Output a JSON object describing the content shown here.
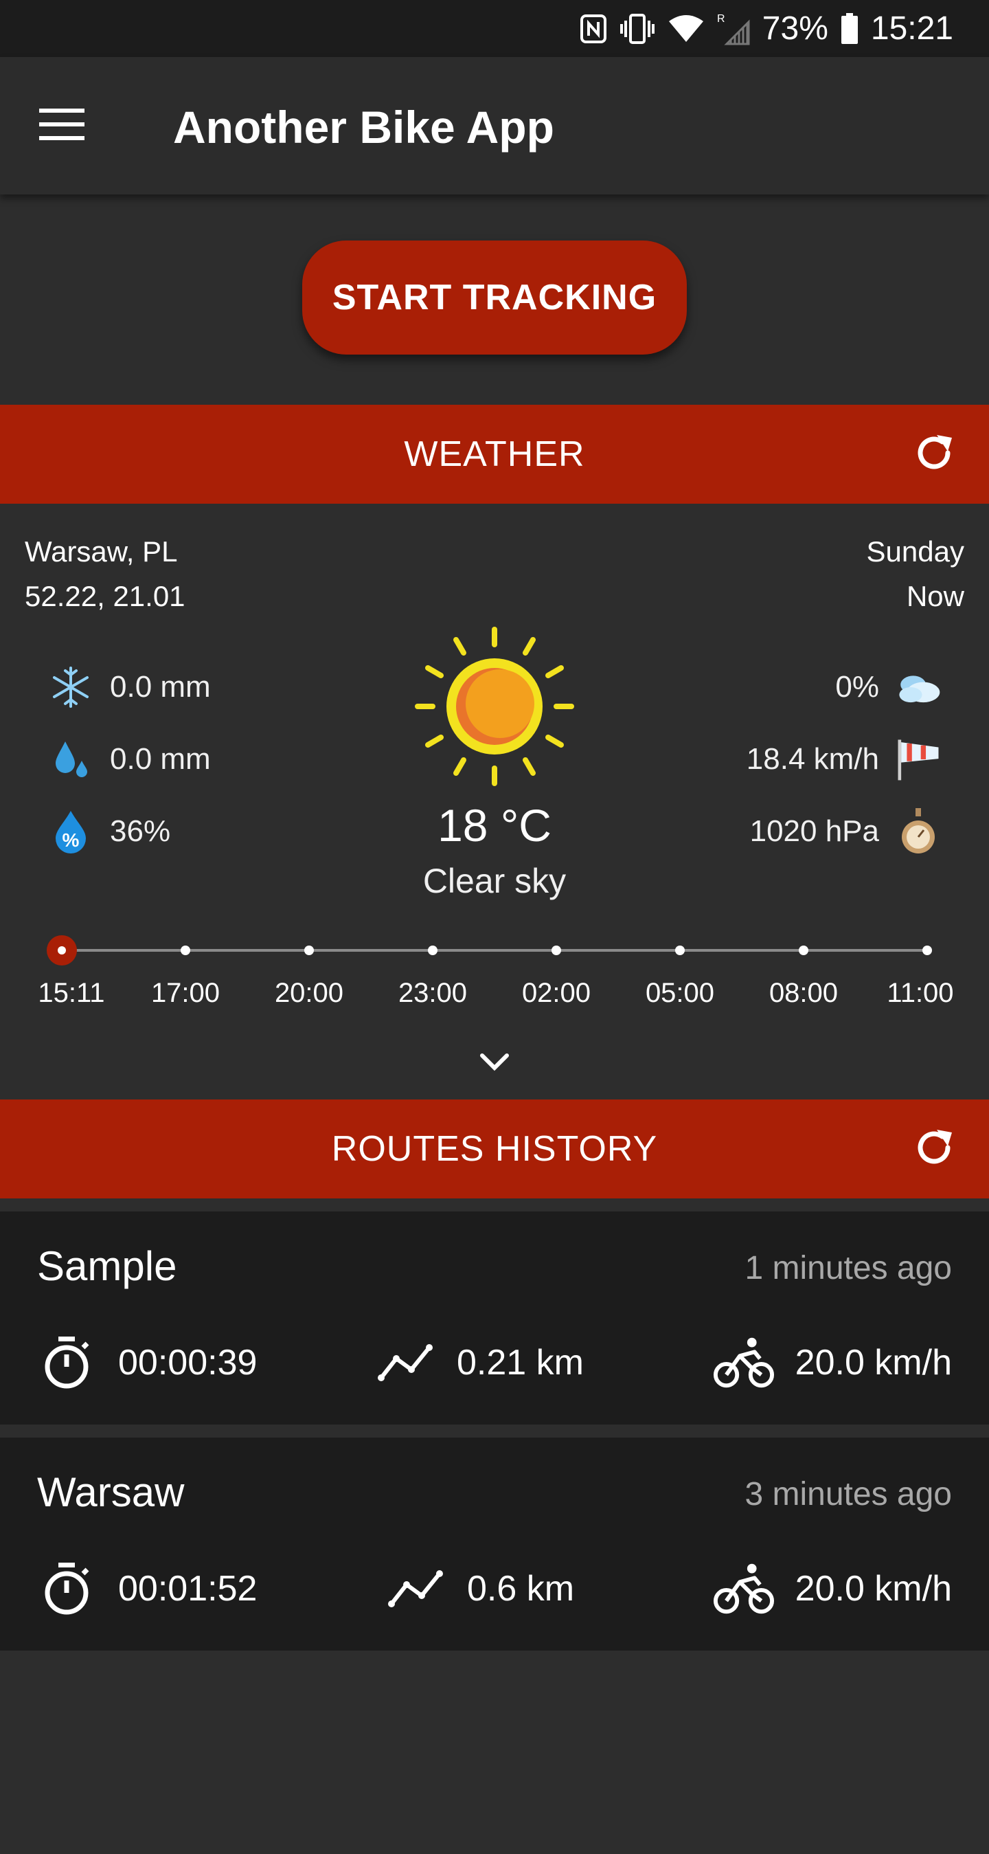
{
  "status_bar": {
    "battery": "73%",
    "time": "15:21",
    "icons": [
      "nfc-icon",
      "vibrate-icon",
      "wifi-icon",
      "signal-icon",
      "battery-icon"
    ]
  },
  "app_bar": {
    "title": "Another Bike App",
    "menu_icon": "hamburger-menu-icon"
  },
  "start_button": {
    "label": "START TRACKING"
  },
  "weather": {
    "header": "WEATHER",
    "location": "Warsaw, PL",
    "coords": "52.22, 21.01",
    "day": "Sunday",
    "when": "Now",
    "snow": "0.0 mm",
    "rain": "0.0 mm",
    "humidity": "36%",
    "clouds": "0%",
    "wind": "18.4 km/h",
    "pressure": "1020 hPa",
    "temperature": "18 °C",
    "condition": "Clear sky",
    "timeline": [
      "15:11",
      "17:00",
      "20:00",
      "23:00",
      "02:00",
      "05:00",
      "08:00",
      "11:00"
    ],
    "selected_index": 0
  },
  "routes": {
    "header": "ROUTES HISTORY",
    "items": [
      {
        "name": "Sample",
        "ago": "1 minutes ago",
        "duration": "00:00:39",
        "distance": "0.21 km",
        "speed": "20.0 km/h"
      },
      {
        "name": "Warsaw",
        "ago": "3 minutes ago",
        "duration": "00:01:52",
        "distance": "0.6 km",
        "speed": "20.0 km/h"
      }
    ]
  },
  "colors": {
    "accent": "#a91f06",
    "background": "#2d2d2d",
    "card": "#1c1c1c",
    "status_bar": "#1c1c1c"
  }
}
